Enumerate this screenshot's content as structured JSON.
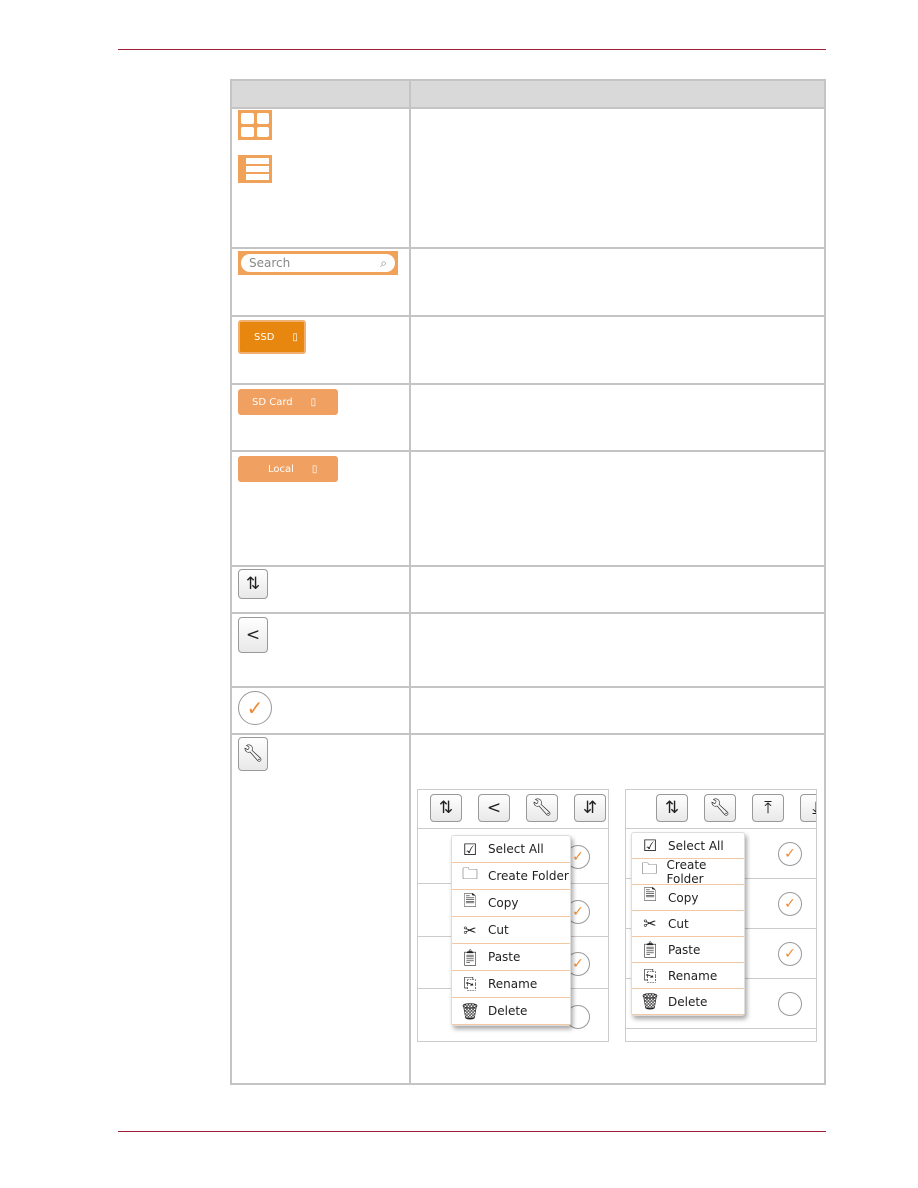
{
  "search": {
    "placeholder": "Search"
  },
  "buttons": {
    "ssd": "SSD",
    "sd_card": "SD Card",
    "local": "Local"
  },
  "icons": {
    "grid": "grid-view-icon",
    "list": "list-view-icon",
    "sync": "sync-icon",
    "share": "share-icon",
    "check": "checkmark-icon",
    "tools": "wrench-icon",
    "search": "magnifier-icon"
  },
  "menu_left": [
    "Select All",
    "Create Folder",
    "Copy",
    "Cut",
    "Paste",
    "Rename",
    "Delete"
  ],
  "menu_right": [
    "Select All",
    "Create Folder",
    "Copy",
    "Cut",
    "Paste",
    "Rename",
    "Delete"
  ],
  "colors": {
    "accent": "#f0a258",
    "rule": "#a0203a"
  }
}
